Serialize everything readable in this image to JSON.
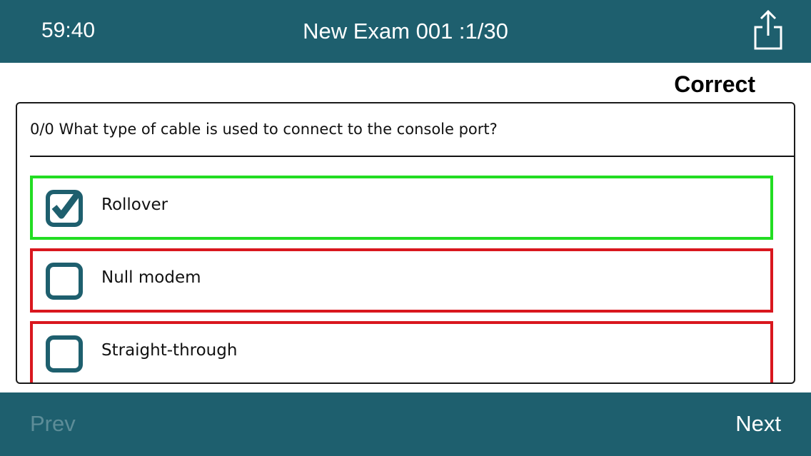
{
  "header": {
    "timer": "59:40",
    "title": "New Exam 001 :1/30",
    "share_icon": "share-icon"
  },
  "status": "Correct",
  "question": {
    "text": "0/0 What type of cable is used to connect to the console port?",
    "options": [
      {
        "label": "Rollover",
        "checked": true,
        "state": "correct"
      },
      {
        "label": "Null modem",
        "checked": false,
        "state": "incorrect"
      },
      {
        "label": "Straight-through",
        "checked": false,
        "state": "incorrect"
      }
    ]
  },
  "footer": {
    "prev_label": "Prev",
    "next_label": "Next"
  },
  "colors": {
    "bar": "#1e5f6e",
    "correct": "#22dd22",
    "incorrect": "#d9171e",
    "checkbox": "#1e5f6e",
    "prev_disabled": "#5d8d98"
  }
}
